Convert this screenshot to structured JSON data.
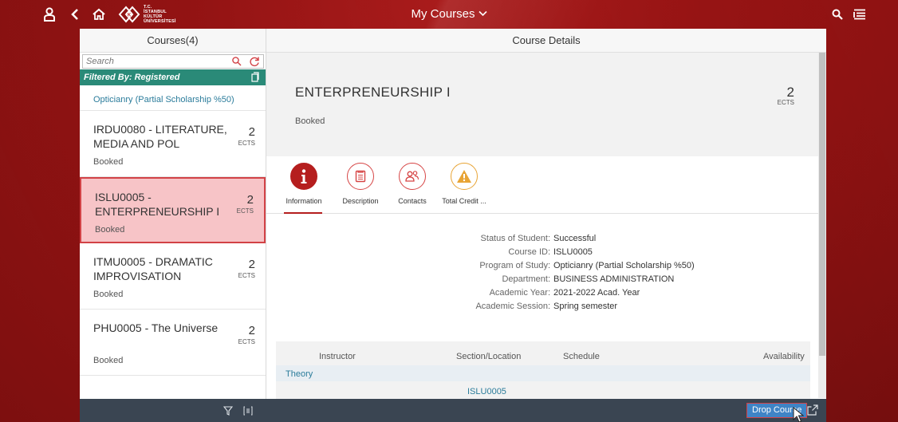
{
  "header": {
    "title": "My Courses",
    "logo_text": [
      "T.C.",
      "İSTANBUL",
      "KÜLTÜR",
      "ÜNİVERSİTESİ"
    ],
    "icons": [
      "person-icon",
      "back-icon",
      "home-icon",
      "search-icon",
      "menu-icon"
    ]
  },
  "master": {
    "title": "Courses(4)",
    "search_placeholder": "Search",
    "filter_text": "Filtered By: Registered",
    "group_label": "Opticianry (Partial Scholarship %50)",
    "items": [
      {
        "title": "IRDU0080 - LITERATURE, MEDIA AND POL",
        "ects": "2",
        "ects_label": "ECTS",
        "status": "Booked"
      },
      {
        "title": "ISLU0005 - ENTERPRENEURSHIP I",
        "ects": "2",
        "ects_label": "ECTS",
        "status": "Booked"
      },
      {
        "title": "ITMU0005 - DRAMATIC IMPROVISATION",
        "ects": "2",
        "ects_label": "ECTS",
        "status": "Booked"
      },
      {
        "title": "PHU0005 - The Universe",
        "ects": "2",
        "ects_label": "ECTS",
        "status": "Booked"
      }
    ]
  },
  "detail": {
    "title": "Course Details",
    "course_title": "ENTERPRENEURSHIP I",
    "status": "Booked",
    "ects": "2",
    "ects_label": "ECTS",
    "tabs": [
      {
        "label": "Information",
        "icon": "info-icon"
      },
      {
        "label": "Description",
        "icon": "document-icon"
      },
      {
        "label": "Contacts",
        "icon": "contacts-icon"
      },
      {
        "label": "Total Credit ...",
        "icon": "warning-icon"
      }
    ],
    "info": [
      {
        "key": "Status of Student:",
        "value": "Successful"
      },
      {
        "key": "Course ID:",
        "value": "ISLU0005"
      },
      {
        "key": "Program of Study:",
        "value": "Opticianry (Partial Scholarship %50)"
      },
      {
        "key": "Department:",
        "value": "BUSINESS ADMINISTRATION"
      },
      {
        "key": "Academic Year:",
        "value": "2021-2022 Acad. Year"
      },
      {
        "key": "Academic Session:",
        "value": "Spring semester"
      }
    ],
    "table": {
      "columns": [
        "Instructor",
        "Section/Location",
        "Schedule",
        "Availability"
      ],
      "group": "Theory",
      "section_link": "ISLU0005"
    },
    "footer": {
      "drop_button": "Drop Course"
    }
  },
  "colors": {
    "brand_red": "#b51e1e",
    "teal": "#2a8a78",
    "link_blue": "#2b7c9b",
    "footer_dark": "#3a4552",
    "button_blue": "#3f84c6",
    "selection": "#f7c4c7"
  }
}
